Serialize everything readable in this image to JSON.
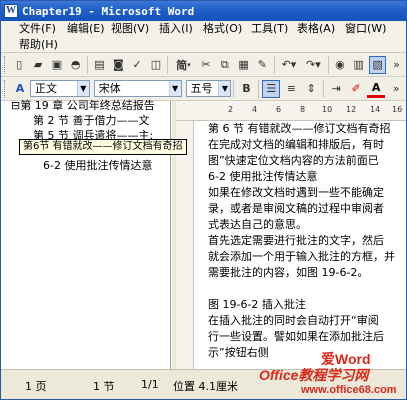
{
  "window": {
    "title": "Chapter19 - Microsoft Word"
  },
  "menu": {
    "items": [
      "文件(F)",
      "编辑(E)",
      "视图(V)",
      "插入(I)",
      "格式(O)",
      "工具(T)",
      "表格(A)",
      "窗口(W)",
      "帮助(H)"
    ]
  },
  "toolbar": {
    "simplified_label": "简",
    "style_value": "正文",
    "font_value": "宋体",
    "size_value": "五号",
    "bold_label": "B",
    "font_color_label": "A"
  },
  "doc_map": {
    "items": [
      "⊟第 19 章  公司年终总结报告",
      "第 2 节  善于借力——文",
      "第 5 节  调兵遣将——主:",
      "⊟第6节  有错就改——修订文档有奇招",
      "6-2  使用批注传情达意"
    ],
    "tooltip": "第6节  有错就改——修订文档有奇招"
  },
  "ruler": {
    "h_labels": [
      "2",
      "4",
      "6",
      "8",
      "10",
      "12",
      "14",
      "16"
    ]
  },
  "document": {
    "lines": [
      "第 6 节  有错就改——修订文档有奇招",
      "在完成对文档的编辑和排版后，有时",
      "图”快速定位文档内容的方法前面已",
      "6-2  使用批注传情达意",
      "如果在修改文档时遇到一些不能确定",
      "录，或者是审阅文稿的过程中审阅者",
      "式表达自己的意思。",
      "首先选定需要进行批注的文字，然后",
      "就会添加一个用于输入批注的方框，并",
      "需要批注的内容，如图 19-6-2。",
      "",
      "图 19-6-2  插入批注",
      "在插入批注的同时会自动打开“审阅",
      "行一些设置。譬如如果在添加批注后",
      "示”按钮右侧"
    ]
  },
  "status": {
    "page": "1 页",
    "section": "1 节",
    "page_of": "1/1",
    "position": "位置 4.1厘米"
  },
  "watermark": {
    "brand": "爱Word",
    "brand2": "Office教程学习网",
    "site": "www.office68.com"
  }
}
